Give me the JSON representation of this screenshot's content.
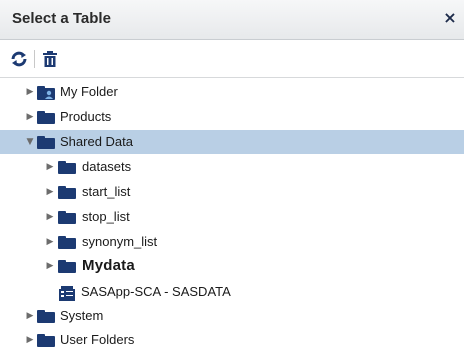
{
  "dialog": {
    "title": "Select a Table",
    "close_label": "×"
  },
  "toolbar": {
    "refresh_icon": "refresh-icon",
    "delete_icon": "trash-icon"
  },
  "tree": {
    "items": [
      {
        "label": "My Folder",
        "expanded": false,
        "selected": false,
        "level": 0,
        "icon": "user-folder-icon"
      },
      {
        "label": "Products",
        "expanded": false,
        "selected": false,
        "level": 0,
        "icon": "folder-icon"
      },
      {
        "label": "Shared Data",
        "expanded": true,
        "selected": true,
        "level": 0,
        "icon": "folder-icon"
      },
      {
        "label": "datasets",
        "expanded": false,
        "selected": false,
        "level": 1,
        "icon": "folder-icon"
      },
      {
        "label": "start_list",
        "expanded": false,
        "selected": false,
        "level": 1,
        "icon": "folder-icon"
      },
      {
        "label": "stop_list",
        "expanded": false,
        "selected": false,
        "level": 1,
        "icon": "folder-icon"
      },
      {
        "label": "synonym_list",
        "expanded": false,
        "selected": false,
        "level": 1,
        "icon": "folder-icon"
      },
      {
        "label": "Mydata",
        "expanded": false,
        "selected": false,
        "level": 1,
        "icon": "folder-icon"
      },
      {
        "label": "SASApp-SCA - SASDATA",
        "expanded": false,
        "selected": false,
        "level": 1,
        "icon": "library-icon"
      },
      {
        "label": "System",
        "expanded": false,
        "selected": false,
        "level": 0,
        "icon": "folder-icon"
      },
      {
        "label": "User Folders",
        "expanded": false,
        "selected": false,
        "level": 0,
        "icon": "folder-icon"
      }
    ]
  },
  "colors": {
    "selection": "#b9cfe5",
    "folder": "#1c3a72",
    "icon_blue": "#1c3a72"
  }
}
